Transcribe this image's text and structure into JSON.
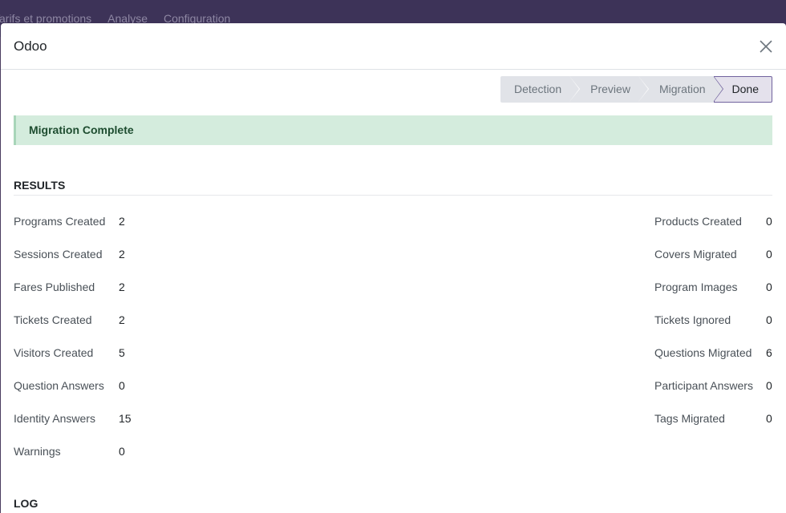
{
  "background_menu": {
    "items": [
      "Tarifs et promotions",
      "Analyse",
      "Configuration"
    ]
  },
  "modal": {
    "title": "Odoo",
    "close_icon": "close-icon"
  },
  "statusbar": {
    "steps": [
      {
        "label": "Detection",
        "active": false
      },
      {
        "label": "Preview",
        "active": false
      },
      {
        "label": "Migration",
        "active": false
      },
      {
        "label": "Done",
        "active": true
      }
    ]
  },
  "alert": {
    "message": "Migration Complete"
  },
  "results": {
    "title": "RESULTS",
    "left": [
      {
        "label": "Programs Created",
        "value": "2"
      },
      {
        "label": "Sessions Created",
        "value": "2"
      },
      {
        "label": "Fares Published",
        "value": "2"
      },
      {
        "label": "Tickets Created",
        "value": "2"
      },
      {
        "label": "Visitors Created",
        "value": "5"
      },
      {
        "label": "Question Answers",
        "value": "0"
      },
      {
        "label": "Identity Answers",
        "value": "15"
      },
      {
        "label": "Warnings",
        "value": "0"
      }
    ],
    "right": [
      {
        "label": "Products Created",
        "value": "0"
      },
      {
        "label": "Covers Migrated",
        "value": "0"
      },
      {
        "label": "Program Images",
        "value": "0"
      },
      {
        "label": "Tickets Ignored",
        "value": "0"
      },
      {
        "label": "Questions Migrated",
        "value": "6"
      },
      {
        "label": "Participant Answers",
        "value": "0"
      },
      {
        "label": "Tags Migrated",
        "value": "0"
      }
    ]
  },
  "log": {
    "title": "LOG"
  },
  "colors": {
    "navbar": "#3d3358",
    "brand": "#71639e",
    "alert_bg": "#d4ecdd",
    "alert_text": "#1e4d30"
  }
}
